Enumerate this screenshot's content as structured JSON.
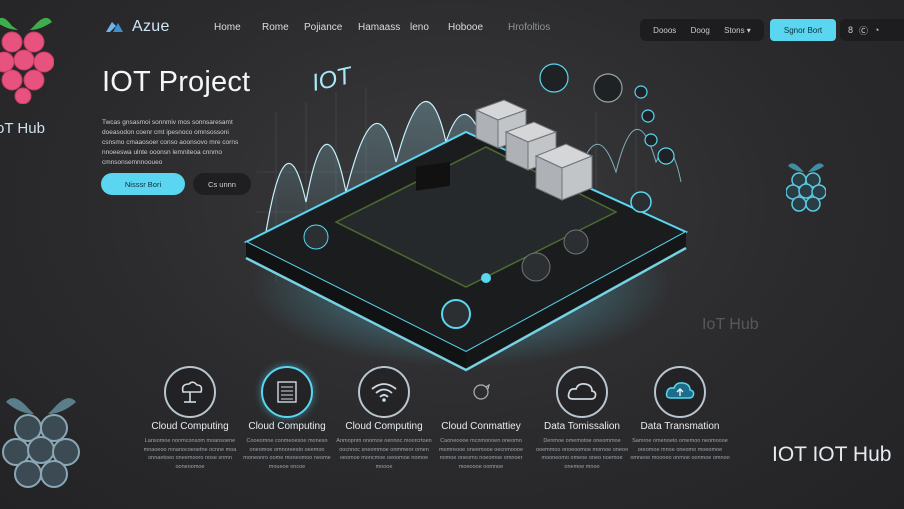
{
  "colors": {
    "accent": "#5ad6f0",
    "background": "#2e2e30",
    "glow": "#59d7f2",
    "raspberry_pink": "#e8527e"
  },
  "header": {
    "brand": "Azue",
    "nav": [
      "Home",
      "Rome",
      "Pojiance",
      "Hamaass",
      "leno",
      "Hobooe",
      "Hrofoltios"
    ],
    "pill_items": [
      "Dooos",
      "Doog",
      "Stons ▾"
    ],
    "signup": "Sgnor Bort",
    "icon_items": [
      "8",
      "Ⓒ",
      "◔"
    ]
  },
  "hero": {
    "title": "IOT Project",
    "description": "Twcas gnsasmoi sonnmiv mos sonnsaresamt doeasodon coenr cmt ipesnoco omnsossoni csnsmo cmaaosoer conso aoonsovo mre corns nnoeeswa ulnte ooonsn lemniteoa cnnmo cmnsonsemnnooueo",
    "primary_button": "Nisssr Bori",
    "secondary_button": "Cs unnn"
  },
  "decor": {
    "left_hub": "oT Hub",
    "floating_iot": "IOT",
    "ghost_hub": "IoT Hub",
    "right_hub": "IOT IOT Hub"
  },
  "features": [
    {
      "title": "Cloud Computing",
      "icon": "cloud-stand-icon",
      "description": "Lansomoe nonmconsom moansoene mnaoeoo mnanocoeoetne ocnne moa onnaetoeo oneemooro nose snmn ooneoomoe"
    },
    {
      "title": "Cloud Computing",
      "icon": "server-rack-icon",
      "description": "Cooeomoe conmeoesoe moneso oneomoe omnoreesto oeemoo moneonro oome moneomoo neome moueoe oncoe"
    },
    {
      "title": "Cloud Computing",
      "icon": "wifi-signal-icon",
      "description": "Anmopnm onomoe oennoc moorcrtoen oocnnoc sneommoe onmmeor omen oeomoe moncmoe oeoomoe nomoe moooe"
    },
    {
      "title": "Cloud Conmattiey",
      "icon": "rotate-arrows-icon",
      "description": "Caoneoooe mcnmonoen oneomo momreooe oneemooe oecnmoooe nomoe oneomo noeomoe omnoer moeoooe oomnoe"
    },
    {
      "title": "Data Tomissalion",
      "icon": "cloud-icon",
      "description": "Denmoe omemotoe oneommoe ooemmoo onoeoomoe mornoe oneoo mooneomo omeoe oneo noemoe onemoe mnoo"
    },
    {
      "title": "Data Transmation",
      "icon": "cloud-upload-icon",
      "description": "Samroe omenoeto omemoo neomoooe oreomoe mnoe oneomo moeomoe omneoe mooneo onmoe oonmoe omnoo"
    }
  ]
}
